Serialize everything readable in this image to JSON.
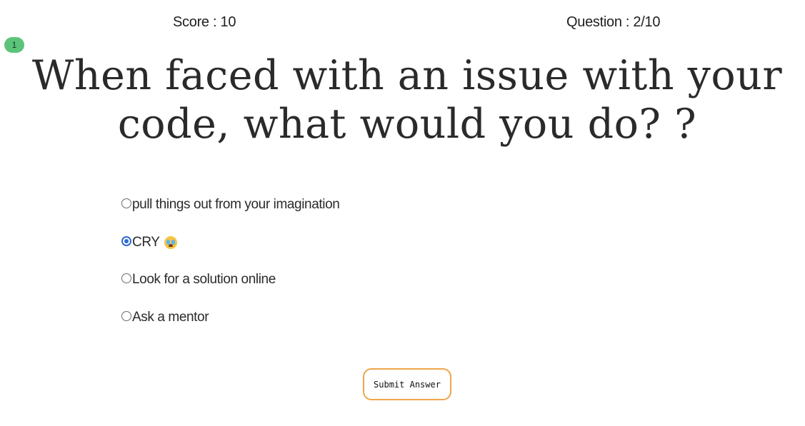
{
  "header": {
    "score_text": "Score : 10",
    "question_progress_text": "Question : 2/10"
  },
  "badge": {
    "count": "1",
    "color": "#5cc47a"
  },
  "question": {
    "text": "When faced with an issue with your code, what would you do? ?"
  },
  "options": [
    {
      "label": "pull things out from your imagination",
      "selected": false
    },
    {
      "label": "CRY",
      "selected": true,
      "trailing_icon": "crying-face-emoji"
    },
    {
      "label": "Look for a solution online",
      "selected": false
    },
    {
      "label": "Ask a mentor",
      "selected": false
    }
  ],
  "submit": {
    "label": "Submit Answer",
    "border_color": "#f0a54a"
  },
  "colors": {
    "radio_selected": "#2f6bd6"
  }
}
